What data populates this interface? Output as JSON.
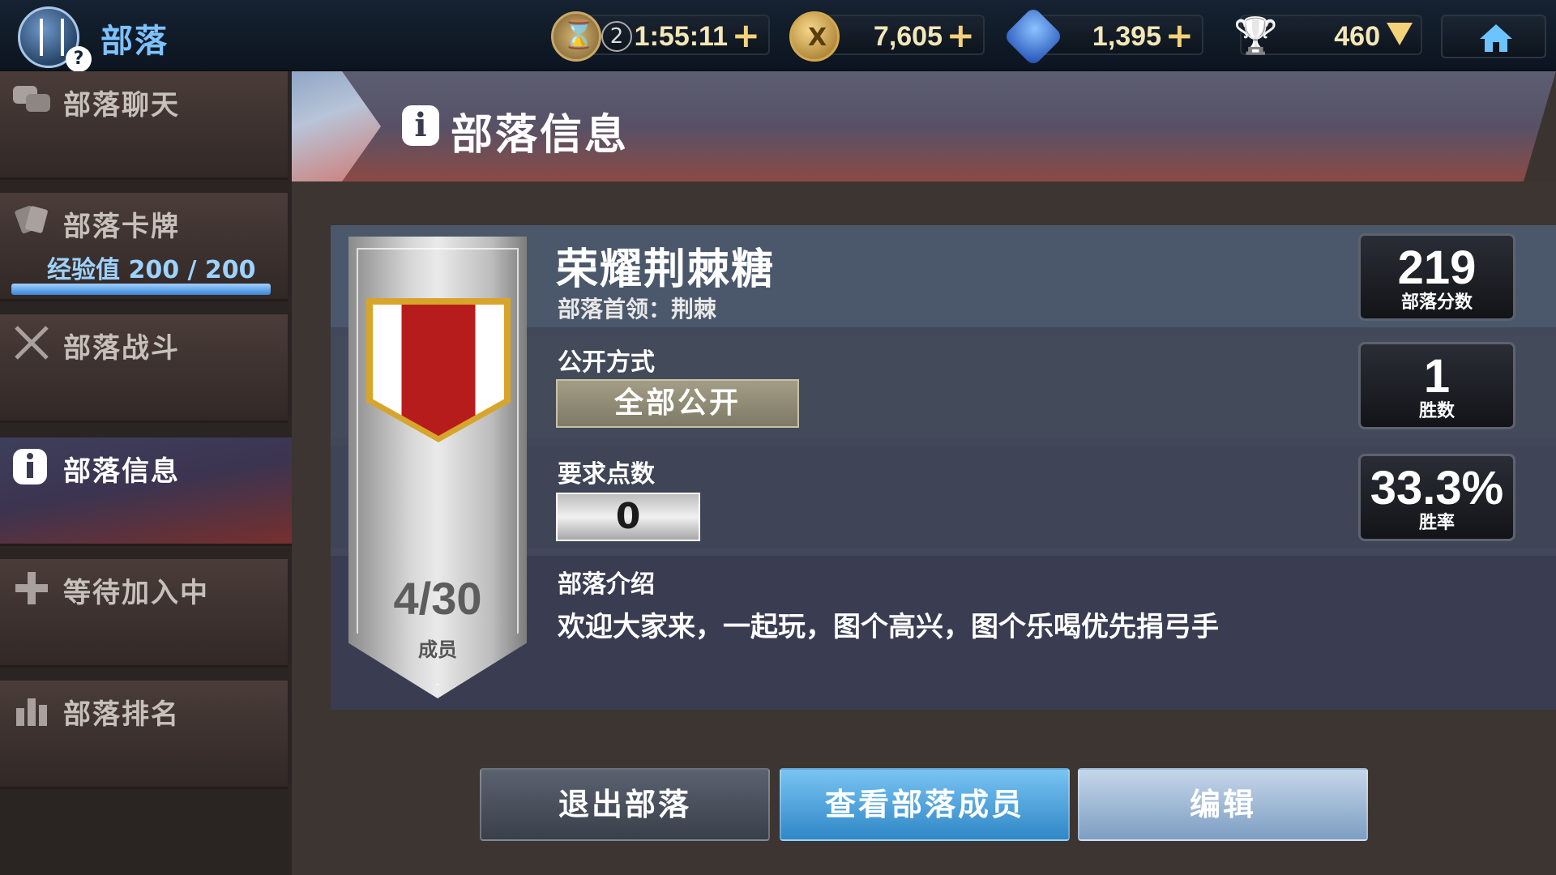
{
  "topbar": {
    "title": "部落",
    "timer": {
      "count": "2",
      "value": "1:55:11",
      "plus": "+"
    },
    "coins": {
      "value": "7,605",
      "plus": "+"
    },
    "gems": {
      "value": "1,395",
      "plus": "+"
    },
    "trophies": {
      "value": "460"
    },
    "icons": [
      "clan-logo-icon",
      "hourglass-icon",
      "coin-icon",
      "gem-icon",
      "trophy-icon",
      "home-icon"
    ]
  },
  "sidebar": {
    "items": [
      {
        "label": "部落聊天",
        "icon": "chat-icon"
      },
      {
        "label": "部落卡牌",
        "icon": "cards-icon",
        "exp_text": "经验值 200 / 200",
        "exp_progress": 1.0
      },
      {
        "label": "部落战斗",
        "icon": "crossed-swords-icon"
      },
      {
        "label": "部落信息",
        "icon": "info-icon",
        "active": true
      },
      {
        "label": "等待加入中",
        "icon": "plus-icon"
      },
      {
        "label": "部落排名",
        "icon": "ranking-icon"
      }
    ]
  },
  "header": {
    "title": "部落信息",
    "icon": "info-icon"
  },
  "clan": {
    "name": "荣耀荆棘糖",
    "leader": "部落首领：荆棘",
    "members": "4/30",
    "members_label": "成员",
    "visibility_label": "公开方式",
    "visibility_value": "全部公开",
    "required_points_label": "要求点数",
    "required_points_value": "0",
    "intro_label": "部落介绍",
    "intro_text": "欢迎大家来，一起玩，图个高兴，图个乐喝优先捐弓手"
  },
  "stats": [
    {
      "value": "219",
      "label": "部落分数"
    },
    {
      "value": "1",
      "label": "胜数"
    },
    {
      "value": "33.3%",
      "label": "胜率"
    }
  ],
  "buttons": {
    "leave": "退出部落",
    "view_members": "查看部落成员",
    "edit": "编辑"
  },
  "colors": {
    "accent_blue": "#7ec2ff",
    "gold": "#f3d27a",
    "emblem_red": "#b71c1c",
    "emblem_gold": "#d7a52b"
  }
}
